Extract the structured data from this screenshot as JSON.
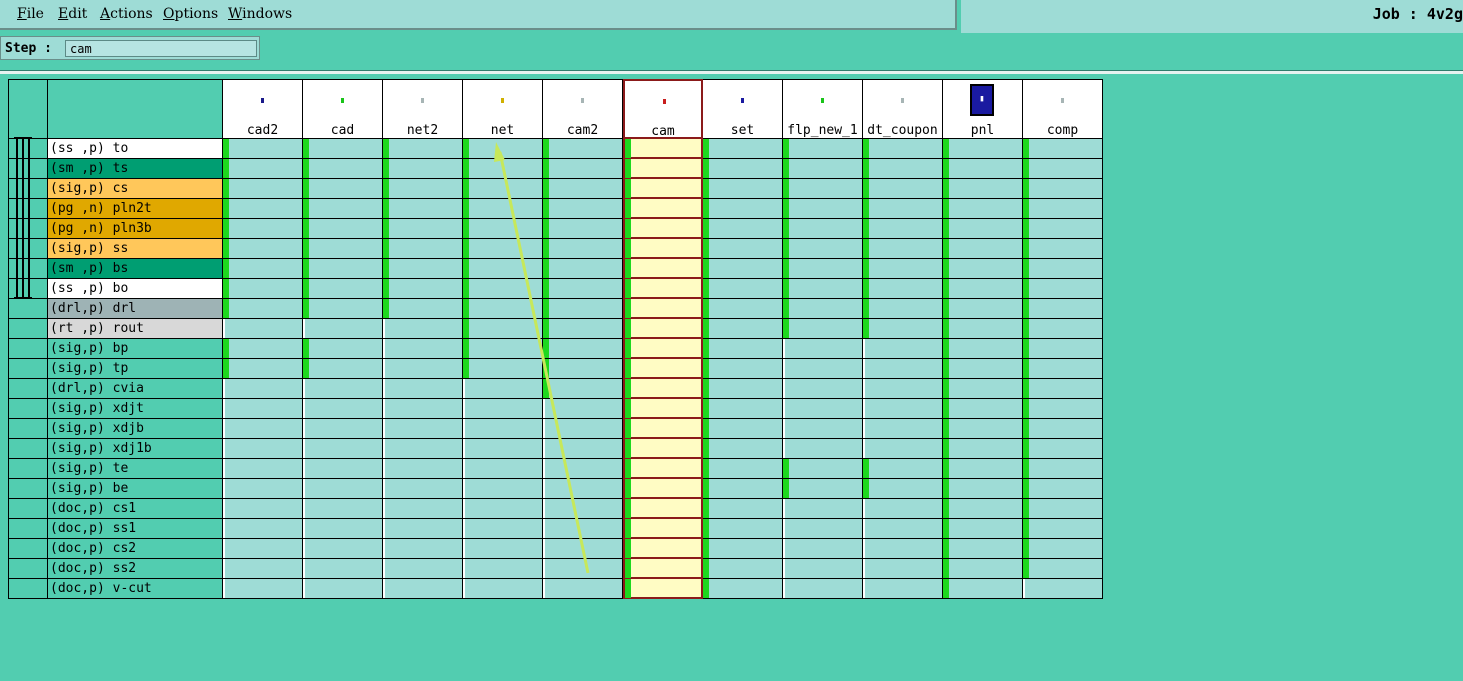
{
  "menu": [
    {
      "key": "F",
      "rest": "ile"
    },
    {
      "key": "E",
      "rest": "dit"
    },
    {
      "key": "A",
      "rest": "ctions"
    },
    {
      "key": "O",
      "rest": "ptions"
    },
    {
      "key": "W",
      "rest": "indows"
    }
  ],
  "job": {
    "label": "Job :",
    "value": "4v2g"
  },
  "step": {
    "label": "Step :",
    "value": "cam"
  },
  "columns": [
    {
      "name": "cad2",
      "icon": "#1a1a8a"
    },
    {
      "name": "cad",
      "icon": "#19c419"
    },
    {
      "name": "net2",
      "icon": "#a7b5b5"
    },
    {
      "name": "net",
      "icon": "#d0b000"
    },
    {
      "name": "cam2",
      "icon": "#a7b5b5"
    },
    {
      "name": "cam",
      "icon": "#c81d1d",
      "selected": true
    },
    {
      "name": "set",
      "icon": "#1a1aa0"
    },
    {
      "name": "flp_new_1",
      "icon": "#19c419"
    },
    {
      "name": "dt_coupon",
      "icon": "#a7b5b5"
    },
    {
      "name": "pnl",
      "icon": "panel"
    },
    {
      "name": "comp",
      "icon": "#a7b5b5"
    }
  ],
  "rows": [
    {
      "name": "(ss ,p) to",
      "bg": "#ffffff",
      "marks": [
        1,
        1,
        1,
        1,
        1,
        1,
        1,
        1,
        1,
        1,
        1
      ]
    },
    {
      "name": "(sm ,p) ts",
      "bg": "#009e72",
      "marks": [
        1,
        1,
        1,
        1,
        1,
        1,
        1,
        1,
        1,
        1,
        1
      ]
    },
    {
      "name": "(sig,p) cs",
      "bg": "#ffc75a",
      "marks": [
        1,
        1,
        1,
        1,
        1,
        1,
        1,
        1,
        1,
        1,
        1
      ]
    },
    {
      "name": "(pg ,n) pln2t",
      "bg": "#e0a800",
      "marks": [
        1,
        1,
        1,
        1,
        1,
        1,
        1,
        1,
        1,
        1,
        1
      ]
    },
    {
      "name": "(pg ,n) pln3b",
      "bg": "#e0a800",
      "marks": [
        1,
        1,
        1,
        1,
        1,
        1,
        1,
        1,
        1,
        1,
        1
      ]
    },
    {
      "name": "(sig,p) ss",
      "bg": "#ffc75a",
      "marks": [
        1,
        1,
        1,
        1,
        1,
        1,
        1,
        1,
        1,
        1,
        1
      ]
    },
    {
      "name": "(sm ,p) bs",
      "bg": "#009e72",
      "marks": [
        1,
        1,
        1,
        1,
        1,
        1,
        1,
        1,
        1,
        1,
        1
      ]
    },
    {
      "name": "(ss ,p) bo",
      "bg": "#ffffff",
      "marks": [
        1,
        1,
        1,
        1,
        1,
        1,
        1,
        1,
        1,
        1,
        1
      ]
    },
    {
      "name": "(drl,p) drl",
      "bg": "#9eb3b5",
      "marks": [
        1,
        1,
        1,
        1,
        1,
        1,
        1,
        1,
        1,
        1,
        1
      ]
    },
    {
      "name": "(rt ,p) rout",
      "bg": "#d8d8d8",
      "marks": [
        0,
        0,
        0,
        1,
        1,
        1,
        1,
        1,
        1,
        1,
        1
      ]
    },
    {
      "name": "(sig,p) bp",
      "bg": "#52cdb0",
      "marks": [
        1,
        1,
        0,
        1,
        1,
        1,
        1,
        0,
        0,
        1,
        1
      ]
    },
    {
      "name": "(sig,p) tp",
      "bg": "#52cdb0",
      "marks": [
        1,
        1,
        0,
        1,
        1,
        1,
        1,
        0,
        0,
        1,
        1
      ]
    },
    {
      "name": "(drl,p) cvia",
      "bg": "#52cdb0",
      "marks": [
        0,
        0,
        0,
        0,
        1,
        1,
        1,
        0,
        0,
        1,
        1
      ]
    },
    {
      "name": "(sig,p) xdjt",
      "bg": "#52cdb0",
      "marks": [
        0,
        0,
        0,
        0,
        0,
        1,
        1,
        0,
        0,
        1,
        1
      ]
    },
    {
      "name": "(sig,p) xdjb",
      "bg": "#52cdb0",
      "marks": [
        0,
        0,
        0,
        0,
        0,
        1,
        1,
        0,
        0,
        1,
        1
      ]
    },
    {
      "name": "(sig,p) xdj1b",
      "bg": "#52cdb0",
      "marks": [
        0,
        0,
        0,
        0,
        0,
        1,
        1,
        0,
        0,
        1,
        1
      ]
    },
    {
      "name": "(sig,p) te",
      "bg": "#52cdb0",
      "marks": [
        0,
        0,
        0,
        0,
        0,
        1,
        1,
        1,
        1,
        1,
        1
      ]
    },
    {
      "name": "(sig,p) be",
      "bg": "#52cdb0",
      "marks": [
        0,
        0,
        0,
        0,
        0,
        1,
        1,
        1,
        1,
        1,
        1
      ]
    },
    {
      "name": "(doc,p) cs1",
      "bg": "#52cdb0",
      "marks": [
        0,
        0,
        0,
        0,
        0,
        1,
        1,
        0,
        0,
        1,
        1
      ]
    },
    {
      "name": "(doc,p) ss1",
      "bg": "#52cdb0",
      "marks": [
        0,
        0,
        0,
        0,
        0,
        1,
        1,
        0,
        0,
        1,
        1
      ]
    },
    {
      "name": "(doc,p) cs2",
      "bg": "#52cdb0",
      "marks": [
        0,
        0,
        0,
        0,
        0,
        1,
        1,
        0,
        0,
        1,
        1
      ]
    },
    {
      "name": "(doc,p) ss2",
      "bg": "#52cdb0",
      "marks": [
        0,
        0,
        0,
        0,
        0,
        1,
        1,
        0,
        0,
        1,
        1
      ]
    },
    {
      "name": "(doc,p) v-cut",
      "bg": "#52cdb0",
      "marks": [
        0,
        0,
        0,
        0,
        0,
        1,
        1,
        0,
        0,
        1,
        0
      ]
    }
  ],
  "colors": {
    "mark": "#1ed81e",
    "cell": "#9edcd6",
    "selected_cell": "#fffcc4",
    "arrow": "#c7e85a"
  }
}
